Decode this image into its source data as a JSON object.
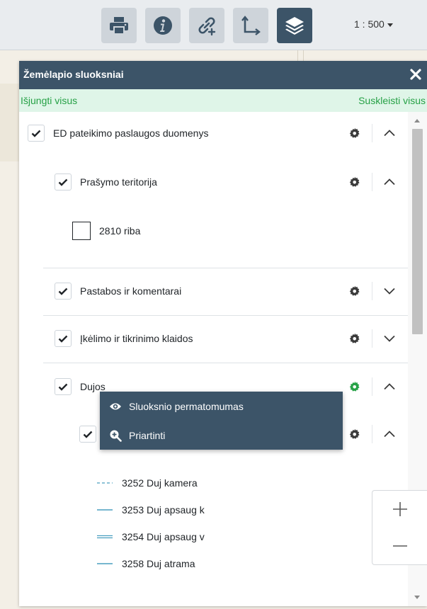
{
  "toolbar": {
    "buttons": [
      {
        "icon": "print-icon"
      },
      {
        "icon": "info-icon"
      },
      {
        "icon": "add-link-icon"
      },
      {
        "icon": "measure-axes-icon"
      },
      {
        "icon": "layers-icon",
        "active": true
      }
    ],
    "scale": "1 : 500"
  },
  "panel": {
    "title": "Žemėlapio sluoksniai",
    "disable_all": "Išjungti visus",
    "collapse_all": "Suskleisti visus"
  },
  "layers": [
    {
      "label": "ED pateikimo paslaugos duomenys",
      "checked": true,
      "expanded": true
    },
    {
      "label": "Prašymo teritorija",
      "checked": true,
      "expanded": true
    },
    {
      "label": "2810 riba",
      "checked": false
    },
    {
      "label": "Pastabos ir komentarai",
      "checked": true,
      "expanded": false
    },
    {
      "label": "Įkėlimo ir tikrinimo klaidos",
      "checked": true,
      "expanded": false
    },
    {
      "label": "Dujos",
      "checked": true,
      "expanded": true,
      "settings_active": true
    }
  ],
  "context_menu": {
    "items": [
      {
        "label": "Sluoksnio permatomumas",
        "icon": "eye-icon"
      },
      {
        "label": "Priartinti",
        "icon": "zoom-in-icon"
      }
    ]
  },
  "legend": [
    {
      "label": "3252 Duj kamera",
      "style": "dashed"
    },
    {
      "label": "3253 Duj apsaug k",
      "style": "solid"
    },
    {
      "label": "3254 Duj apsaug v",
      "style": "double"
    },
    {
      "label": "3258 Duj atrama",
      "style": "solid"
    }
  ],
  "colors": {
    "header": "#3c5468",
    "accent_green": "#26a146",
    "actions_bg": "#dff5e8",
    "legend_line": "#4a9fbf"
  }
}
